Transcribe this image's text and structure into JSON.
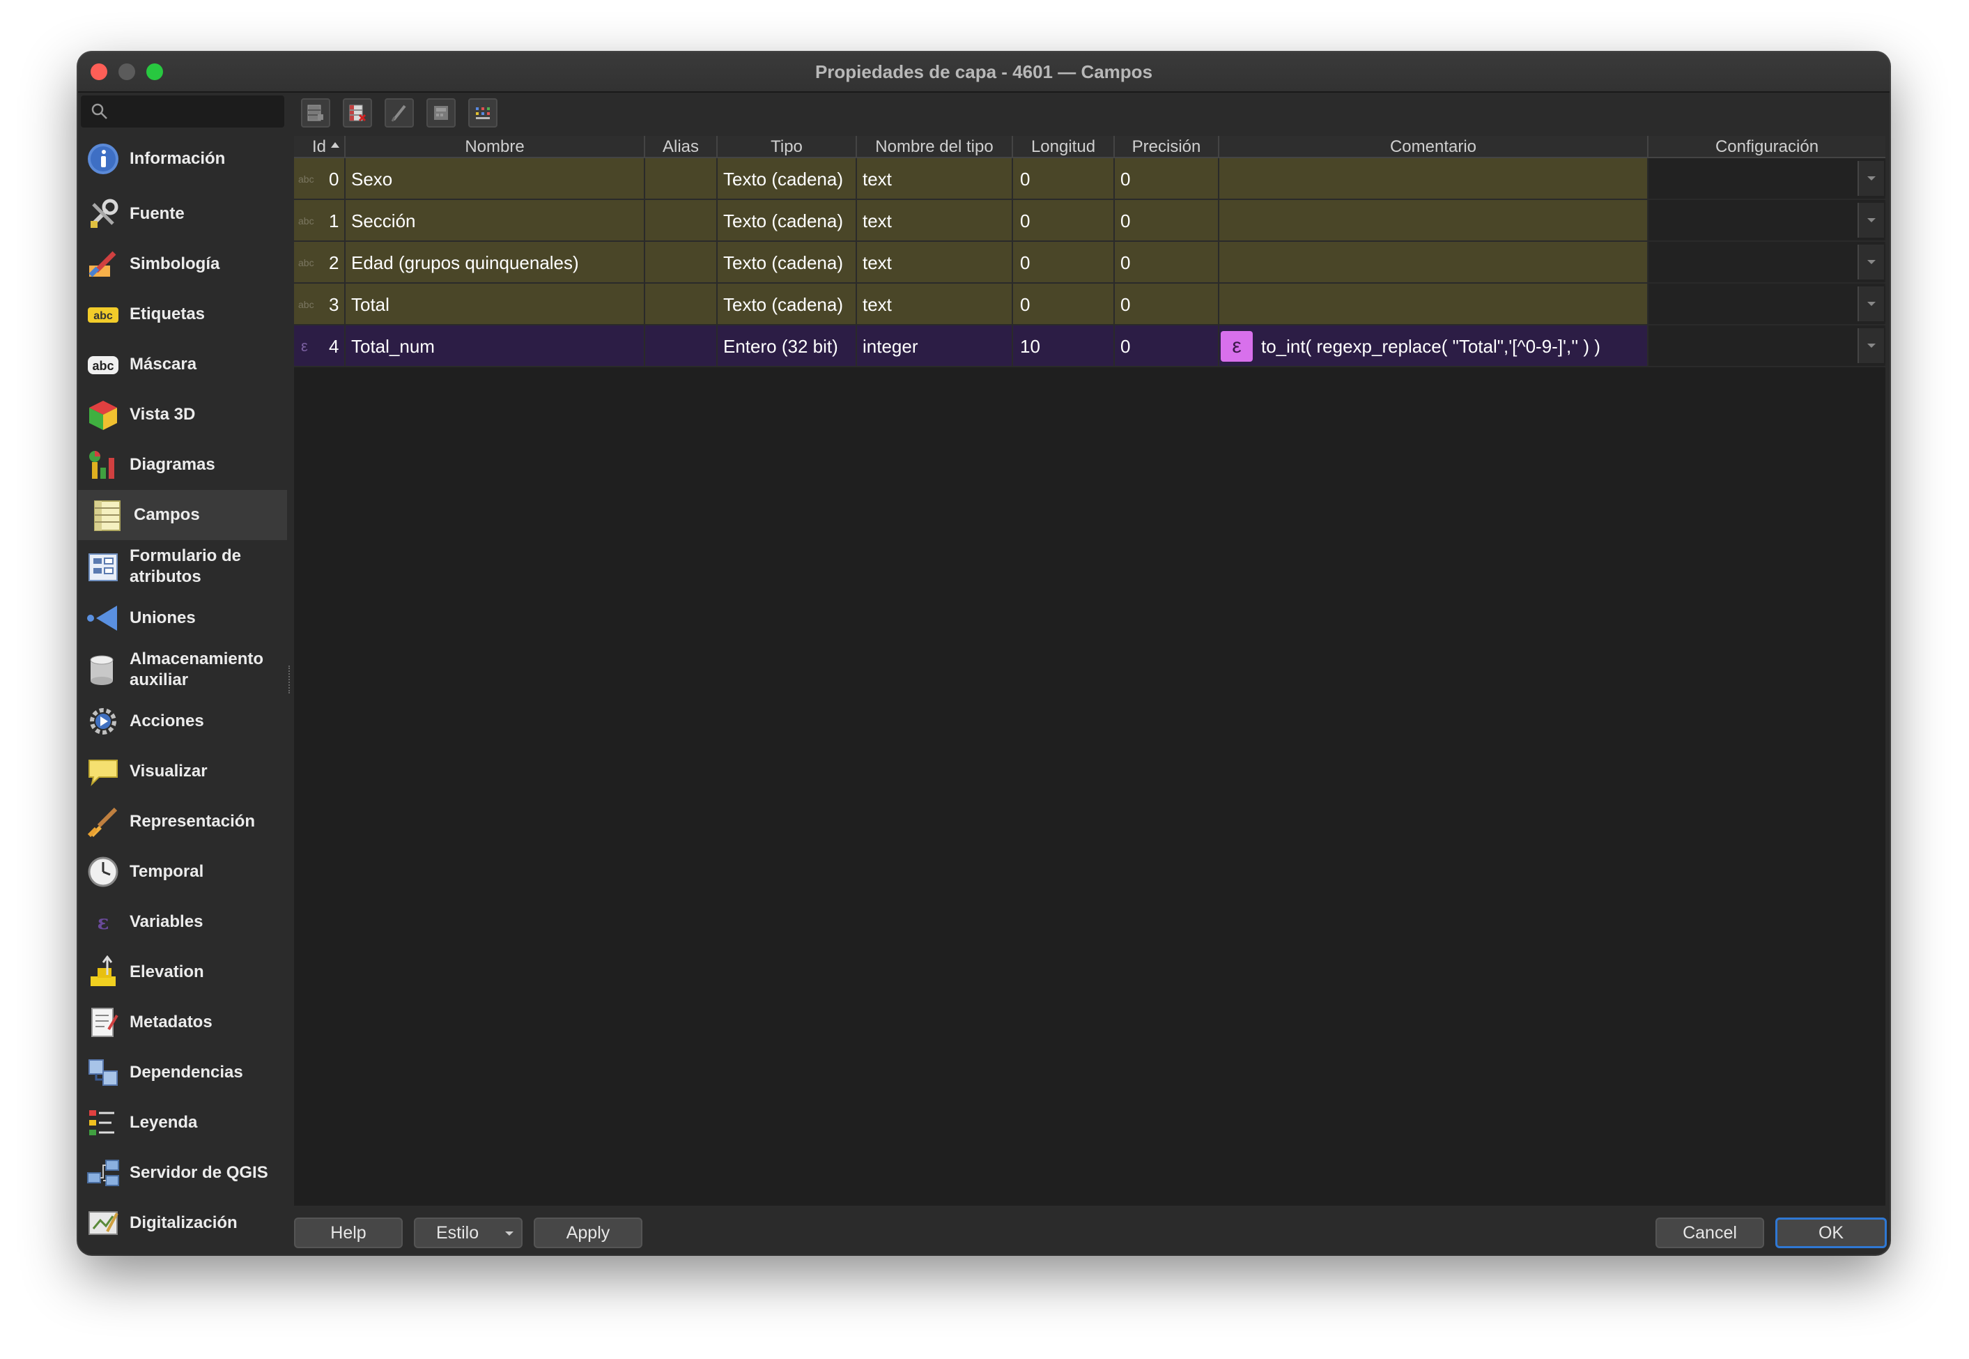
{
  "window": {
    "title": "Propiedades de capa - 4601 — Campos"
  },
  "sidebar": {
    "items": [
      {
        "label": "Información",
        "icon": "info-icon"
      },
      {
        "label": "Fuente",
        "icon": "source-tools-icon"
      },
      {
        "label": "Simbología",
        "icon": "symbology-brush-icon"
      },
      {
        "label": "Etiquetas",
        "icon": "labels-abc-icon"
      },
      {
        "label": "Máscara",
        "icon": "mask-abc-icon"
      },
      {
        "label": "Vista 3D",
        "icon": "cube-3d-icon"
      },
      {
        "label": "Diagramas",
        "icon": "diagrams-icon"
      },
      {
        "label": "Campos",
        "icon": "fields-table-icon"
      },
      {
        "label": "Formulario de atributos",
        "icon": "attribute-form-icon"
      },
      {
        "label": "Uniones",
        "icon": "joins-icon"
      },
      {
        "label": "Almacenamiento auxiliar",
        "icon": "auxiliary-storage-icon"
      },
      {
        "label": "Acciones",
        "icon": "actions-gear-icon"
      },
      {
        "label": "Visualizar",
        "icon": "display-speech-icon"
      },
      {
        "label": "Representación",
        "icon": "rendering-brush-icon"
      },
      {
        "label": "Temporal",
        "icon": "clock-icon"
      },
      {
        "label": "Variables",
        "icon": "variables-icon"
      },
      {
        "label": "Elevation",
        "icon": "elevation-icon"
      },
      {
        "label": "Metadatos",
        "icon": "metadata-icon"
      },
      {
        "label": "Dependencias",
        "icon": "dependencies-icon"
      },
      {
        "label": "Leyenda",
        "icon": "legend-icon"
      },
      {
        "label": "Servidor de QGIS",
        "icon": "qgis-server-icon"
      },
      {
        "label": "Digitalización",
        "icon": "digitizing-icon"
      }
    ],
    "selected": "Campos"
  },
  "toolbar": {
    "buttons": [
      "new-field-icon",
      "delete-field-icon",
      "toggle-editing-icon",
      "field-calculator-icon",
      "organize-columns-icon"
    ]
  },
  "table": {
    "headers": [
      "Id",
      "Nombre",
      "Alias",
      "Tipo",
      "Nombre del tipo",
      "Longitud",
      "Precisión",
      "Comentario",
      "Configuración"
    ],
    "rows": [
      {
        "badge": "abc",
        "id": "0",
        "nombre": "Sexo",
        "alias": "",
        "tipo": "Texto (cadena)",
        "nombre_tipo": "text",
        "longitud": "0",
        "precision": "0",
        "comentario": ""
      },
      {
        "badge": "abc",
        "id": "1",
        "nombre": "Sección",
        "alias": "",
        "tipo": "Texto (cadena)",
        "nombre_tipo": "text",
        "longitud": "0",
        "precision": "0",
        "comentario": ""
      },
      {
        "badge": "abc",
        "id": "2",
        "nombre": "Edad (grupos quinquenales)",
        "alias": "",
        "tipo": "Texto (cadena)",
        "nombre_tipo": "text",
        "longitud": "0",
        "precision": "0",
        "comentario": ""
      },
      {
        "badge": "abc",
        "id": "3",
        "nombre": "Total",
        "alias": "",
        "tipo": "Texto (cadena)",
        "nombre_tipo": "text",
        "longitud": "0",
        "precision": "0",
        "comentario": ""
      },
      {
        "badge": "ε",
        "id": "4",
        "nombre": "Total_num",
        "alias": "",
        "tipo": "Entero (32 bit)",
        "nombre_tipo": "integer",
        "longitud": "10",
        "precision": "0",
        "comentario": "to_int( regexp_replace( \"Total\",'[^0-9-]','' ) )",
        "expression_badge": "ε"
      }
    ]
  },
  "buttons": {
    "help": "Help",
    "estilo": "Estilo",
    "apply": "Apply",
    "cancel": "Cancel",
    "ok": "OK"
  },
  "colors": {
    "olive_row": "#4a4628",
    "expression_row": "#2c1d45",
    "expression_badge": "#d870ec",
    "ok_border": "#2f78d4"
  }
}
